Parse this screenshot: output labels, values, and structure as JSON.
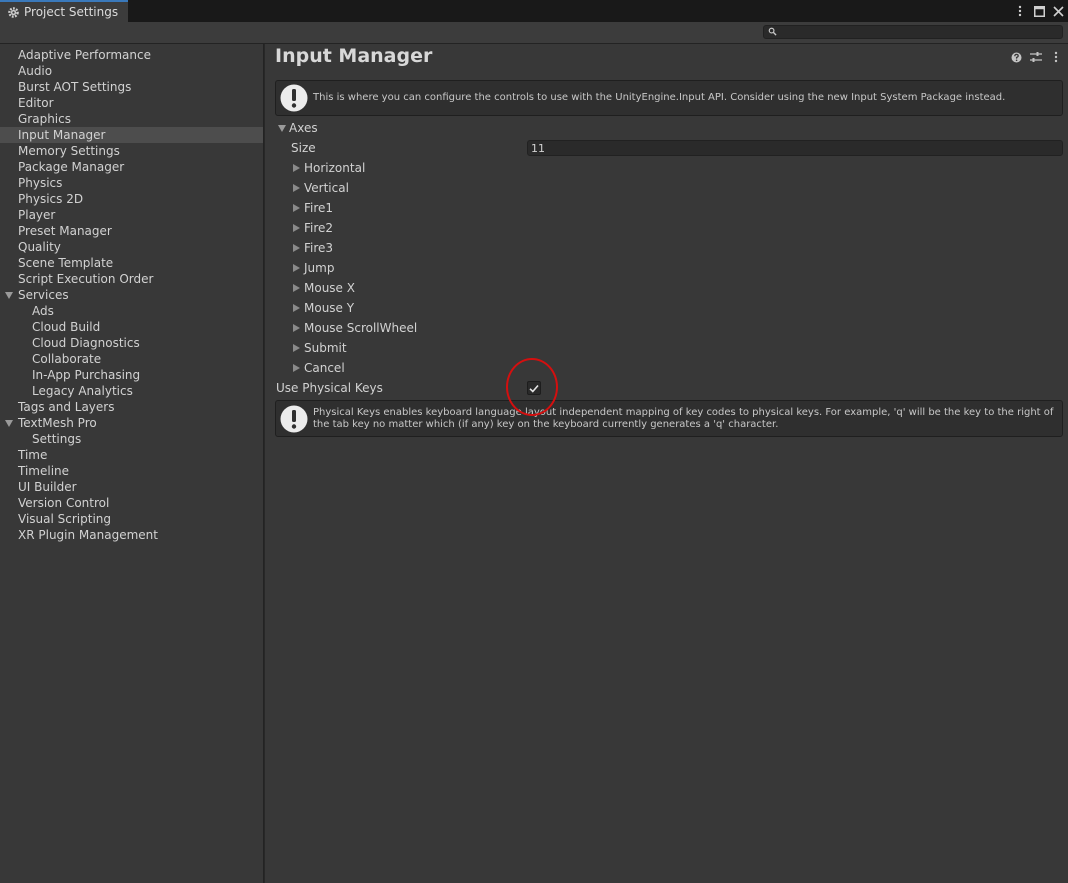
{
  "window": {
    "tab_title": "Project Settings",
    "accent_color": "#3a79bb"
  },
  "toolbar": {
    "search_value": "",
    "search_placeholder": ""
  },
  "sidebar": {
    "items": [
      {
        "label": "Adaptive Performance",
        "level": 0
      },
      {
        "label": "Audio",
        "level": 0
      },
      {
        "label": "Burst AOT Settings",
        "level": 0
      },
      {
        "label": "Editor",
        "level": 0
      },
      {
        "label": "Graphics",
        "level": 0
      },
      {
        "label": "Input Manager",
        "level": 0,
        "selected": true
      },
      {
        "label": "Memory Settings",
        "level": 0
      },
      {
        "label": "Package Manager",
        "level": 0
      },
      {
        "label": "Physics",
        "level": 0
      },
      {
        "label": "Physics 2D",
        "level": 0
      },
      {
        "label": "Player",
        "level": 0
      },
      {
        "label": "Preset Manager",
        "level": 0
      },
      {
        "label": "Quality",
        "level": 0
      },
      {
        "label": "Scene Template",
        "level": 0
      },
      {
        "label": "Script Execution Order",
        "level": 0
      },
      {
        "label": "Services",
        "level": 0,
        "expanded": true
      },
      {
        "label": "Ads",
        "level": 1
      },
      {
        "label": "Cloud Build",
        "level": 1
      },
      {
        "label": "Cloud Diagnostics",
        "level": 1
      },
      {
        "label": "Collaborate",
        "level": 1
      },
      {
        "label": "In-App Purchasing",
        "level": 1
      },
      {
        "label": "Legacy Analytics",
        "level": 1
      },
      {
        "label": "Tags and Layers",
        "level": 0
      },
      {
        "label": "TextMesh Pro",
        "level": 0,
        "expanded": true
      },
      {
        "label": "Settings",
        "level": 1
      },
      {
        "label": "Time",
        "level": 0
      },
      {
        "label": "Timeline",
        "level": 0
      },
      {
        "label": "UI Builder",
        "level": 0
      },
      {
        "label": "Version Control",
        "level": 0
      },
      {
        "label": "Visual Scripting",
        "level": 0
      },
      {
        "label": "XR Plugin Management",
        "level": 0
      }
    ]
  },
  "main": {
    "title": "Input Manager",
    "info_message": "This is where you can configure the controls to use with the UnityEngine.Input API. Consider using the new Input System Package instead.",
    "axes_label": "Axes",
    "size_label": "Size",
    "size_value": "11",
    "axes": [
      "Horizontal",
      "Vertical",
      "Fire1",
      "Fire2",
      "Fire3",
      "Jump",
      "Mouse X",
      "Mouse Y",
      "Mouse ScrollWheel",
      "Submit",
      "Cancel"
    ],
    "physical_keys_label": "Use Physical Keys",
    "physical_keys_checked": true,
    "physical_keys_message": "Physical Keys enables keyboard language layout independent mapping of key codes to physical keys. For example, 'q' will be the key to the right of the tab key no matter which (if any) key on the keyboard currently generates a 'q' character."
  },
  "annotation": {
    "color": "#d40f0f"
  }
}
